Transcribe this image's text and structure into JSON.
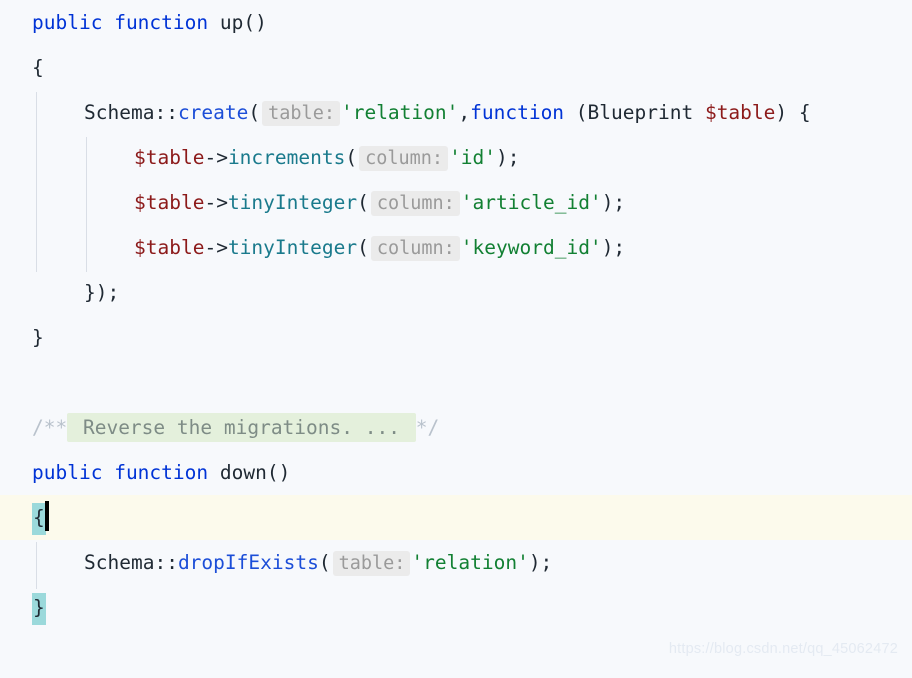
{
  "editor": {
    "language": "PHP",
    "background_color": "#F7F9FC",
    "current_line_color": "#FCFAEC",
    "brace_match_color": "#9BD9DB",
    "fold_highlight_color": "#E4F0DC",
    "hint_chip_bg_color": "#EBEBEB",
    "hint_chip_text_color": "#9A9A9A",
    "keyword_color": "#0033D6",
    "string_color": "#128033",
    "variable_color": "#8C1A1A",
    "method_color": "#1A7A8C",
    "caret_color": "#000000"
  },
  "watermark": {
    "text": "https://blog.csdn.net/qq_45062472"
  },
  "code": {
    "line1": {
      "kw_public": "public",
      "kw_function": "function",
      "name": "up",
      "parens": "()"
    },
    "line2": {
      "brace": "{"
    },
    "line4": {
      "schema": "Schema",
      "scope": "::",
      "method": "create",
      "open_paren": "(",
      "hint": "table:",
      "string": "'relation'",
      "comma": ",",
      "kw_function": "function",
      "space_paren": " (",
      "type": "Blueprint",
      "variable": "$table",
      "close": ") {"
    },
    "line5": {
      "variable": "$table",
      "arrow": "->",
      "method": "increments",
      "open_paren": "(",
      "hint": "column:",
      "string": "'id'",
      "close": ");"
    },
    "line6": {
      "variable": "$table",
      "arrow": "->",
      "method": "tinyInteger",
      "open_paren": "(",
      "hint": "column:",
      "string": "'article_id'",
      "close": ");"
    },
    "line7": {
      "variable": "$table",
      "arrow": "->",
      "method": "tinyInteger",
      "open_paren": "(",
      "hint": "column:",
      "string": "'keyword_id'",
      "close": ");"
    },
    "line8": {
      "text": "});"
    },
    "line9": {
      "brace": "}"
    },
    "line11": {
      "prefix": "/**",
      "folded_text": " Reverse the migrations. ... ",
      "suffix": "*/"
    },
    "line12": {
      "kw_public": "public",
      "kw_function": "function",
      "name": "down",
      "parens": "()"
    },
    "line13": {
      "brace": "{"
    },
    "line14": {
      "schema": "Schema",
      "scope": "::",
      "method": "dropIfExists",
      "open_paren": "(",
      "hint": "table:",
      "string": "'relation'",
      "close": ");"
    },
    "line15": {
      "brace": "}"
    }
  }
}
